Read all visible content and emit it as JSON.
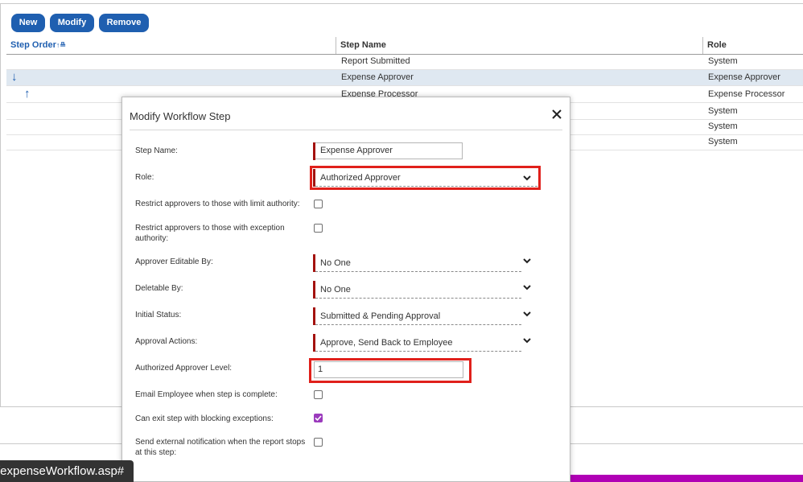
{
  "toolbar": {
    "new_label": "New",
    "modify_label": "Modify",
    "remove_label": "Remove"
  },
  "grid": {
    "headers": {
      "step_order": "Step Order",
      "sort_indicator": "↑≞",
      "step_name": "Step Name",
      "role": "Role"
    },
    "rows": [
      {
        "step_name": "Report Submitted",
        "role": "System"
      },
      {
        "step_name": "Expense Approver",
        "role": "Expense Approver"
      },
      {
        "step_name": "Expense Processor",
        "role": "Expense Processor"
      },
      {
        "step_name": "",
        "role": "System"
      },
      {
        "step_name": "",
        "role": "System"
      },
      {
        "step_name": "",
        "role": "System"
      }
    ],
    "move_down_icon": "↓",
    "move_up_icon": "↑"
  },
  "dialog": {
    "title": "Modify Workflow Step",
    "close_icon": "close-icon",
    "fields": {
      "step_name": {
        "label": "Step Name:",
        "value": "Expense Approver"
      },
      "role": {
        "label": "Role:",
        "value": "Authorized Approver"
      },
      "restrict_limit": {
        "label": "Restrict approvers to those with limit authority:",
        "checked": false
      },
      "restrict_exception": {
        "label": "Restrict approvers to those with exception authority:",
        "checked": false
      },
      "approver_editable_by": {
        "label": "Approver Editable By:",
        "value": "No One"
      },
      "deletable_by": {
        "label": "Deletable By:",
        "value": "No One"
      },
      "initial_status": {
        "label": "Initial Status:",
        "value": "Submitted & Pending Approval"
      },
      "approval_actions": {
        "label": "Approval Actions:",
        "value": "Approve, Send Back to Employee"
      },
      "authorized_approver_level": {
        "label": "Authorized Approver Level:",
        "value": "1"
      },
      "email_employee": {
        "label": "Email Employee when step is complete:",
        "checked": false
      },
      "can_exit_step": {
        "label": "Can exit step with blocking exceptions:",
        "checked": true
      },
      "send_external": {
        "label": "Send external notification when the report stops at this step:",
        "checked": false
      }
    }
  },
  "status_bar": {
    "url": "/expenseWorkflow.asp#"
  },
  "colors": {
    "accent": "#1f5fb0",
    "required": "#a4120f",
    "highlight": "#e0201b",
    "checkbox_on": "#9b3bbd",
    "status_bar": "#b000b5"
  }
}
